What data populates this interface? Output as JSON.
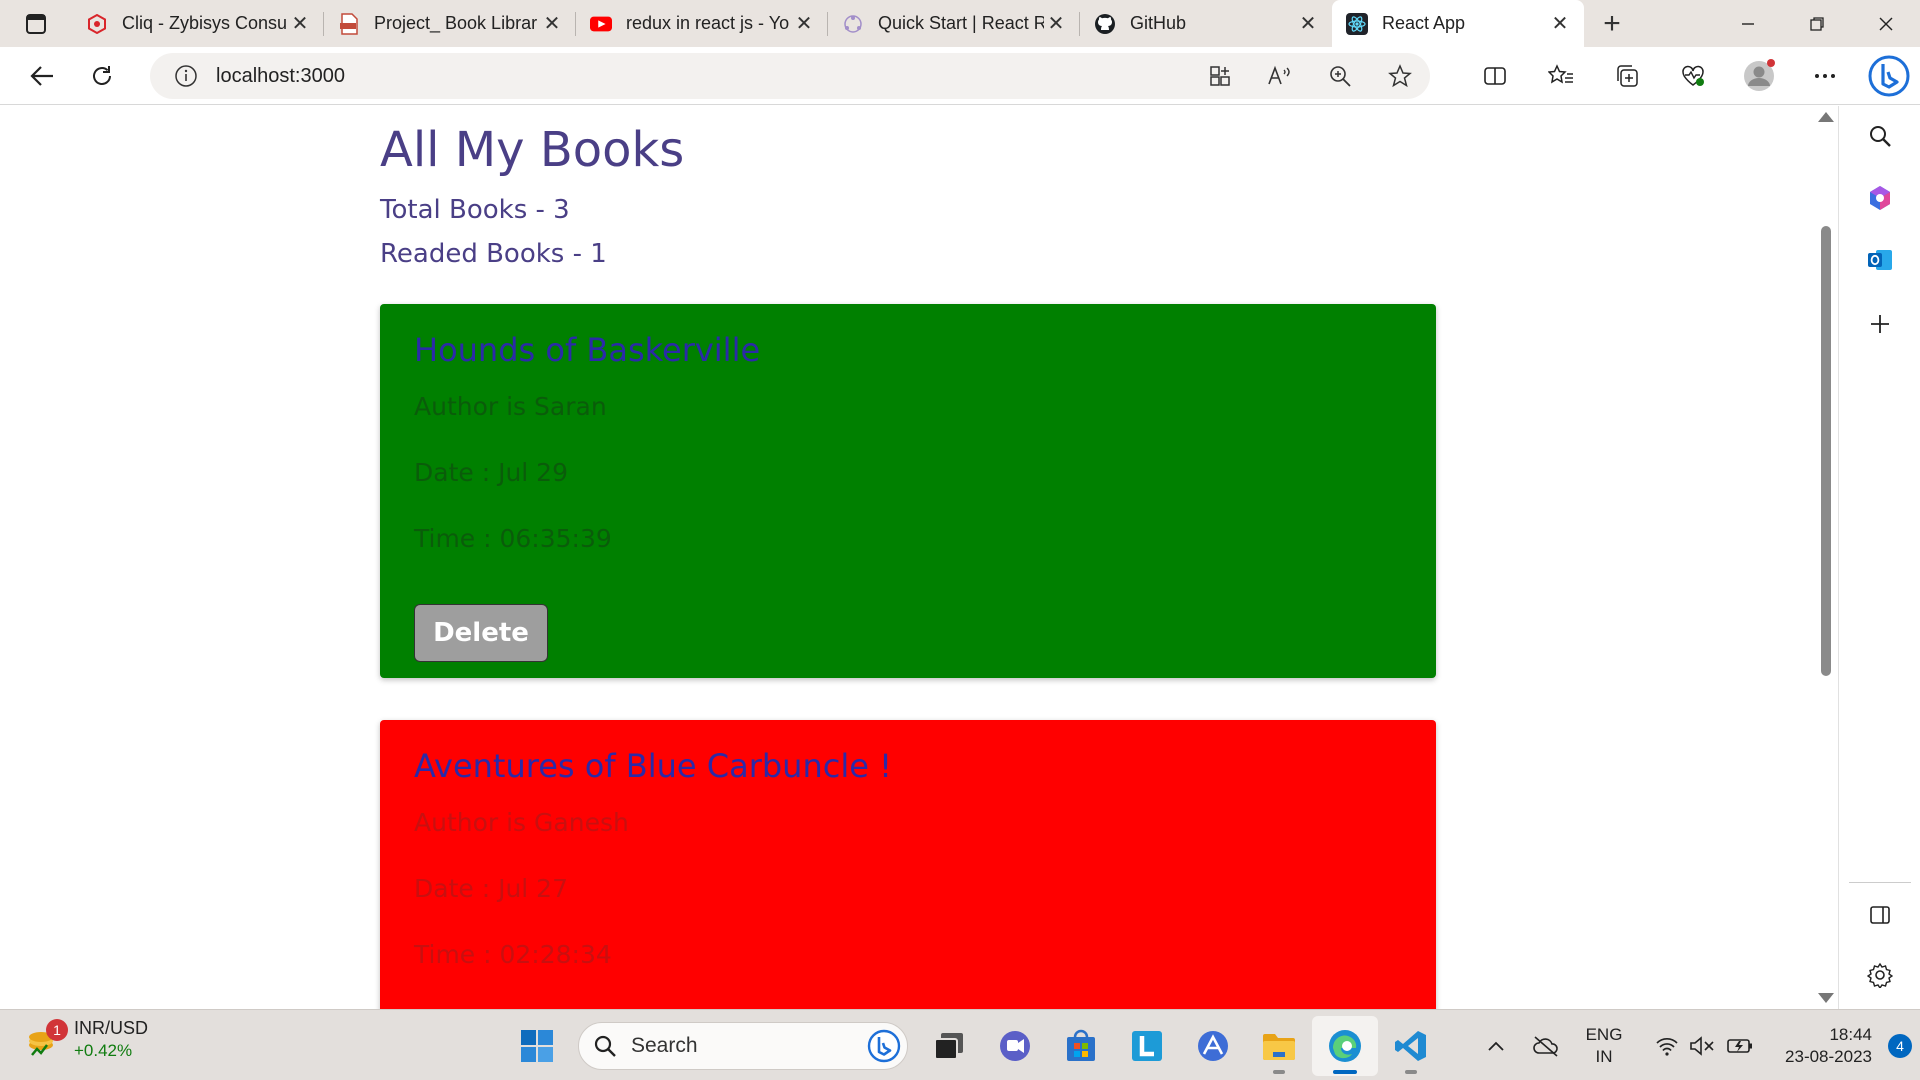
{
  "tabs": [
    {
      "label": "Cliq - Zybisys Consu",
      "icon": "cliq-icon"
    },
    {
      "label": "Project_ Book Librar",
      "icon": "pdf-icon"
    },
    {
      "label": "redux in react js - Yo",
      "icon": "youtube-icon"
    },
    {
      "label": "Quick Start | React R",
      "icon": "redux-icon"
    },
    {
      "label": "GitHub",
      "icon": "github-icon"
    },
    {
      "label": "React App",
      "icon": "react-icon",
      "active": true
    }
  ],
  "address": {
    "url": "localhost:3000"
  },
  "page": {
    "title": "All My Books",
    "total_books": "Total Books - 3",
    "readed_books": "Readed Books - 1"
  },
  "books": [
    {
      "title": "Hounds of Baskerville",
      "author": "Author is Saran",
      "date": "Date : Jul 29",
      "time": "Time : 06:35:39",
      "delete_label": "Delete",
      "card_color": "#008000"
    },
    {
      "title": "Aventures of Blue Carbuncle !",
      "author": "Author is Ganesh",
      "date": "Date : Jul 27",
      "time": "Time : 02:28:34",
      "card_color": "#ff0000"
    }
  ],
  "taskbar": {
    "widget_badge": "1",
    "widget_title": "INR/USD",
    "widget_change": "+0.42%",
    "search_label": "Search",
    "lang_line1": "ENG",
    "lang_line2": "IN",
    "time": "18:44",
    "date": "23-08-2023",
    "notification_count": "4"
  },
  "colors": {
    "accent": "#0067c0",
    "title_text": "#4a3f86",
    "book_title": "#2b2aa8"
  }
}
